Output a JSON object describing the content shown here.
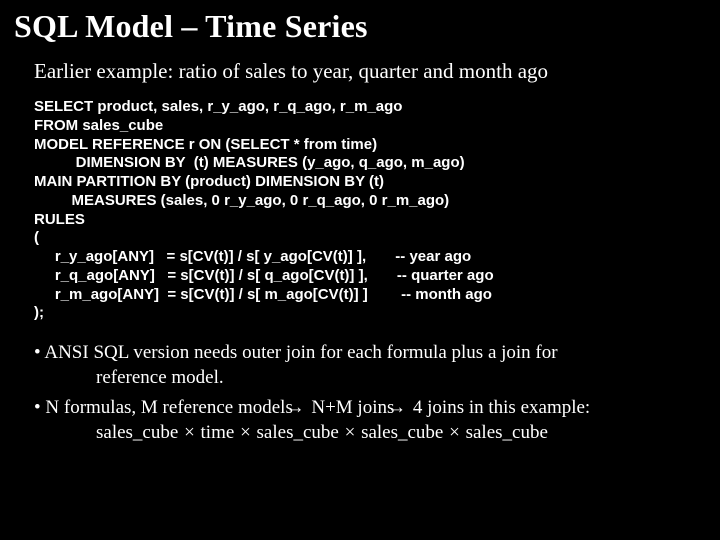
{
  "title": "SQL Model – Time Series",
  "subtitle": "Earlier example:  ratio of sales to year, quarter and month ago",
  "code": "SELECT product, sales, r_y_ago, r_q_ago, r_m_ago\nFROM sales_cube\nMODEL REFERENCE r ON (SELECT * from time)\n          DIMENSION BY  (t) MEASURES (y_ago, q_ago, m_ago)\nMAIN PARTITION BY (product) DIMENSION BY (t)\n         MEASURES (sales, 0 r_y_ago, 0 r_q_ago, 0 r_m_ago)\nRULES\n(\n     r_y_ago[ANY]   = s[CV(t)] / s[ y_ago[CV(t)] ],       -- year ago\n     r_q_ago[ANY]   = s[CV(t)] / s[ q_ago[CV(t)] ],       -- quarter ago\n     r_m_ago[ANY]  = s[CV(t)] / s[ m_ago[CV(t)] ]        -- month ago\n);",
  "bullets": {
    "b1_line1": "• ANSI SQL version needs outer join for each formula plus a join for",
    "b1_line2": "reference model.",
    "b2_pre": "• N formulas, M reference models ",
    "b2_mid": " N+M joins ",
    "b2_post": " 4 joins in this example:",
    "b2_sub_a": "sales_cube ",
    "b2_sub_b": " time ",
    "b2_sub_c": " sales_cube ",
    "b2_sub_d": " sales_cube ",
    "b2_sub_e": " sales_cube"
  },
  "glyphs": {
    "arrow": "→",
    "times": "×"
  }
}
